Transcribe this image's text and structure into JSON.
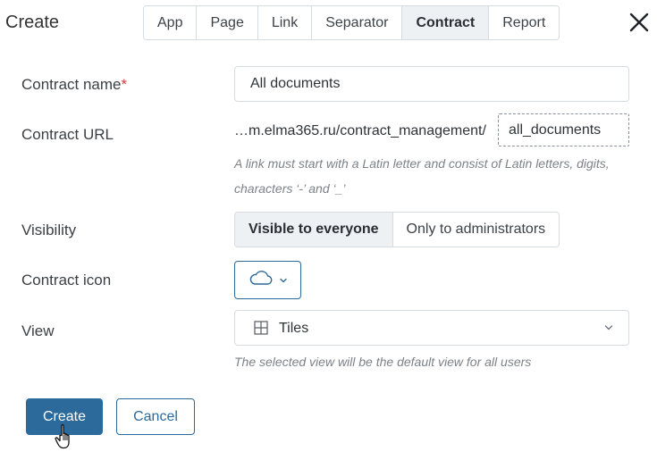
{
  "header": {
    "title": "Create",
    "tabs": [
      {
        "label": "App"
      },
      {
        "label": "Page"
      },
      {
        "label": "Link"
      },
      {
        "label": "Separator"
      },
      {
        "label": "Contract"
      },
      {
        "label": "Report"
      }
    ],
    "active_tab": "Contract"
  },
  "form": {
    "name": {
      "label": "Contract name",
      "required_mark": "*",
      "value": "All documents"
    },
    "url": {
      "label": "Contract URL",
      "prefix": "…m.elma365.ru/contract_management/",
      "value": "all_documents",
      "hint_line1": "A link must start with a Latin letter and consist of Latin letters, digits,",
      "hint_line2": "characters ‘-’ and ‘_’"
    },
    "visibility": {
      "label": "Visibility",
      "options": [
        "Visible to everyone",
        "Only to administrators"
      ],
      "selected": "Visible to everyone"
    },
    "icon": {
      "label": "Contract icon",
      "value_icon": "cloud-icon"
    },
    "view": {
      "label": "View",
      "value": "Tiles",
      "value_icon": "grid-icon",
      "hint": "The selected view will be the default view for all users"
    }
  },
  "footer": {
    "create_label": "Create",
    "cancel_label": "Cancel"
  },
  "colors": {
    "accent": "#2b6a9b",
    "required": "#d23a3a",
    "active_bg": "#eef1f4",
    "border": "#d6dbe0"
  }
}
